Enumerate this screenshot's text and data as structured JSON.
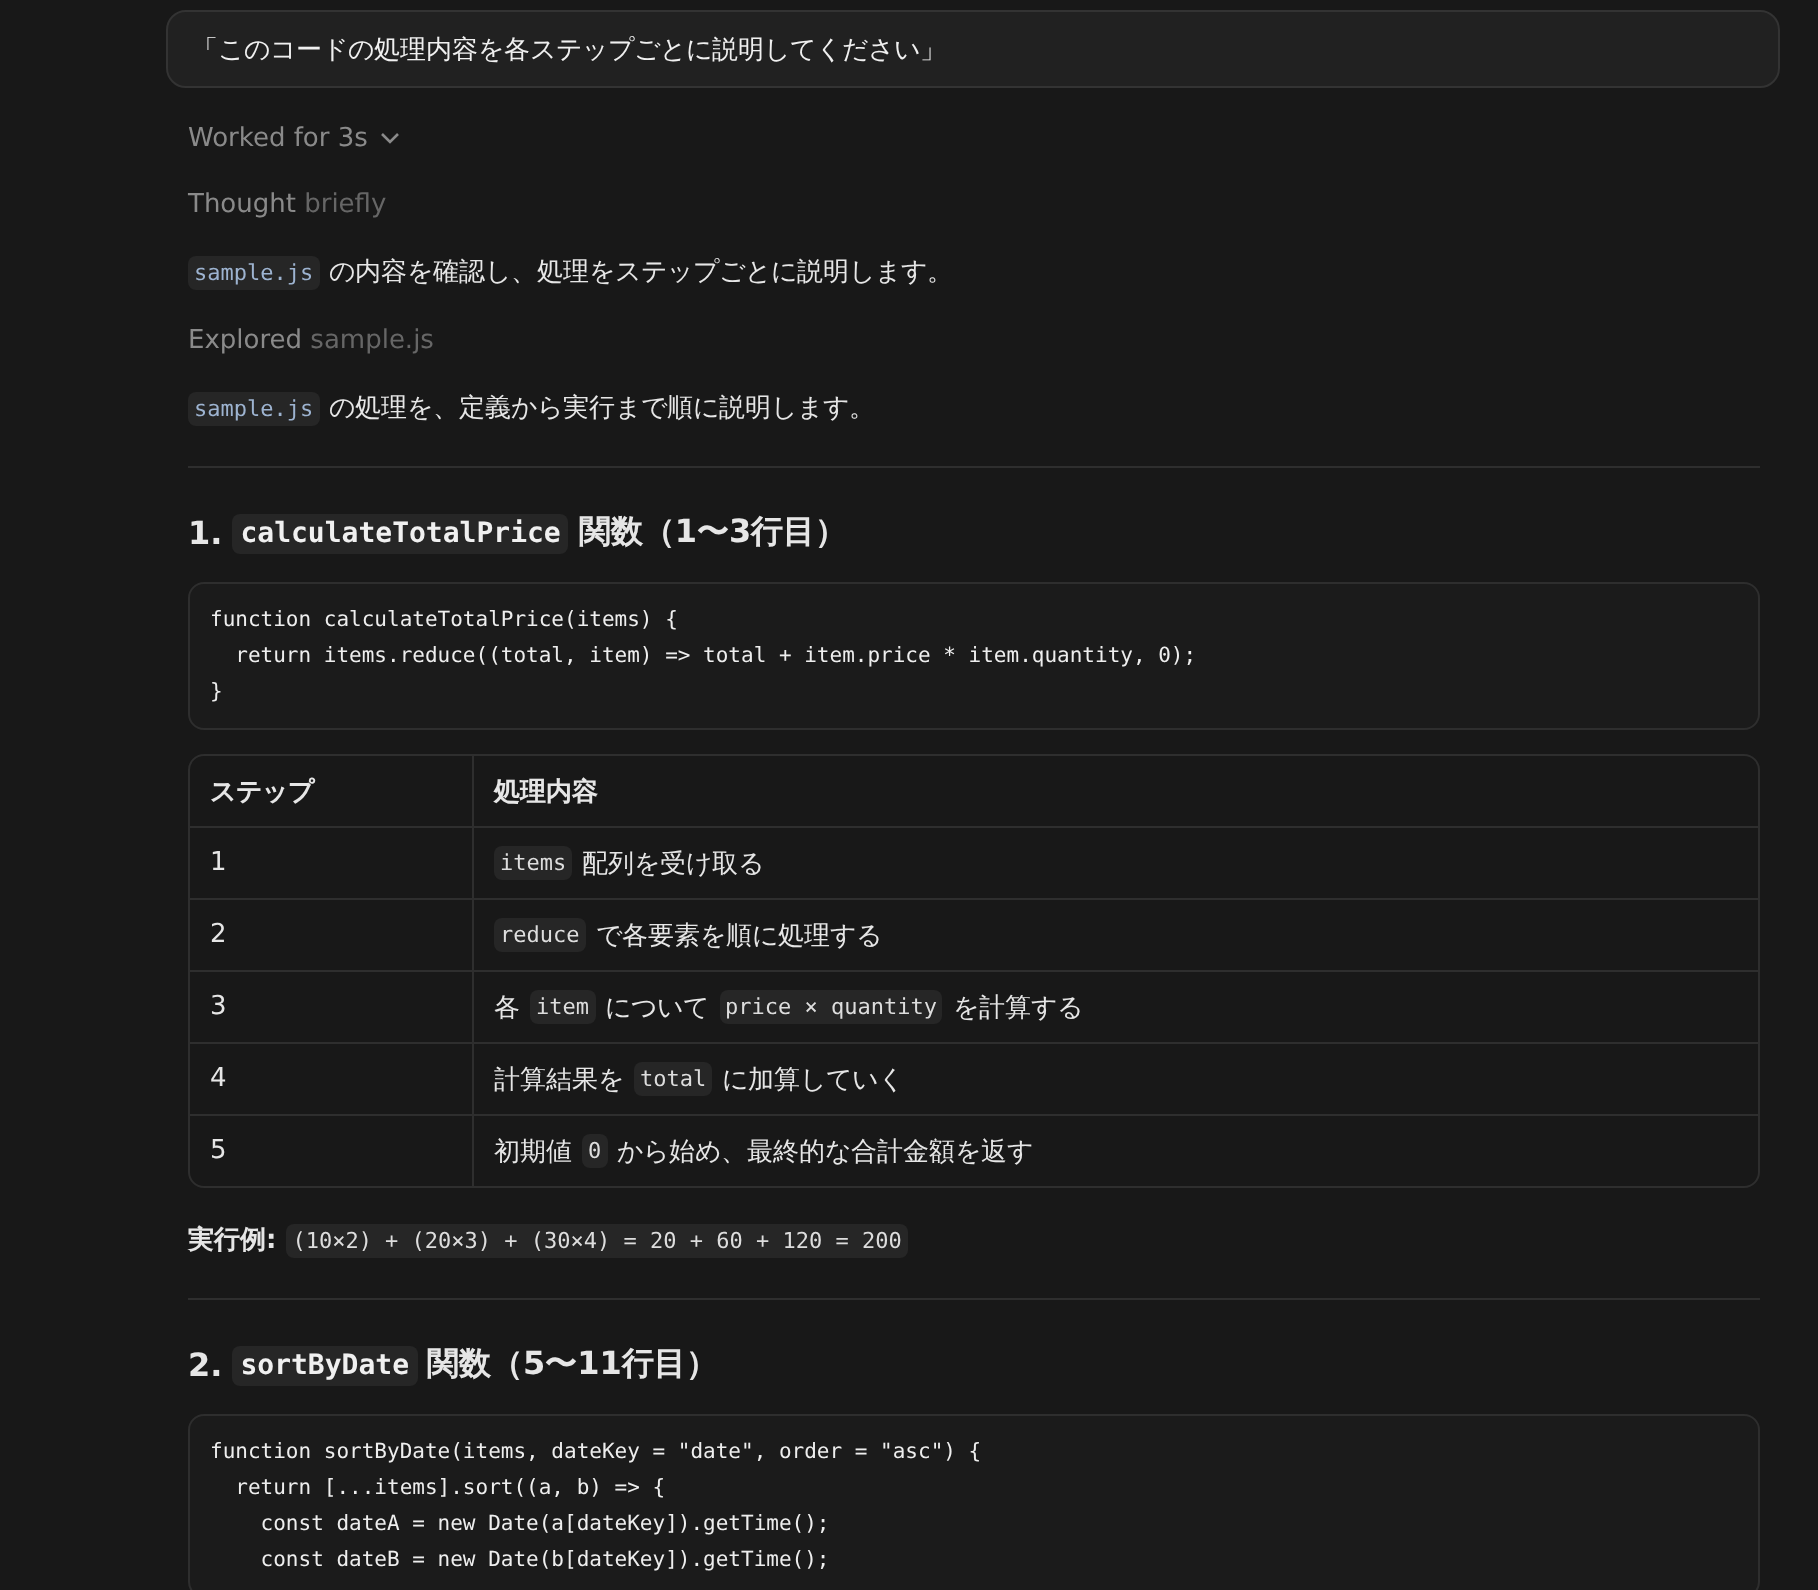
{
  "prompt": "「このコードの処理内容を各ステップごとに説明してください」",
  "worked": {
    "label": "Worked for 3s",
    "expanded": false
  },
  "blocks": [
    {
      "kind": "activity",
      "verb": "Thought",
      "detail": "briefly"
    },
    {
      "kind": "para",
      "parts": [
        {
          "kind": "code",
          "text": "sample.js"
        },
        {
          "kind": "text",
          "text": "の内容を確認し、処理をステップごとに説明します。"
        }
      ]
    },
    {
      "kind": "activity",
      "verb": "Explored",
      "detail": "sample.js"
    },
    {
      "kind": "para",
      "parts": [
        {
          "kind": "code",
          "text": "sample.js"
        },
        {
          "kind": "text",
          "text": "の処理を、定義から実行まで順に説明します。"
        }
      ]
    },
    {
      "kind": "rule"
    },
    {
      "kind": "heading",
      "parts": [
        {
          "kind": "text",
          "text": "1."
        },
        {
          "kind": "code",
          "text": "calculateTotalPrice"
        },
        {
          "kind": "text",
          "text": "関数（1〜3行目）"
        }
      ]
    },
    {
      "kind": "codeblock",
      "lines": [
        "function calculateTotalPrice(items) {",
        "  return items.reduce((total, item) => total + item.price * item.quantity, 0);",
        "}"
      ]
    },
    {
      "kind": "table",
      "columns": [
        "ステップ",
        "処理内容"
      ],
      "rows": [
        {
          "step": "1",
          "parts": [
            {
              "kind": "code",
              "text": "items"
            },
            {
              "kind": "text",
              "text": "配列を受け取る"
            }
          ]
        },
        {
          "step": "2",
          "parts": [
            {
              "kind": "code",
              "text": "reduce"
            },
            {
              "kind": "text",
              "text": "で各要素を順に処理する"
            }
          ]
        },
        {
          "step": "3",
          "parts": [
            {
              "kind": "text",
              "text": "各"
            },
            {
              "kind": "code",
              "text": "item"
            },
            {
              "kind": "text",
              "text": "について"
            },
            {
              "kind": "code",
              "text": "price × quantity"
            },
            {
              "kind": "text",
              "text": "を計算する"
            }
          ]
        },
        {
          "step": "4",
          "parts": [
            {
              "kind": "text",
              "text": "計算結果を"
            },
            {
              "kind": "code",
              "text": "total"
            },
            {
              "kind": "text",
              "text": "に加算していく"
            }
          ]
        },
        {
          "step": "5",
          "parts": [
            {
              "kind": "text",
              "text": "初期値"
            },
            {
              "kind": "code",
              "text": "0"
            },
            {
              "kind": "text",
              "text": "から始め、最終的な合計金額を返す"
            }
          ]
        }
      ]
    },
    {
      "kind": "para",
      "parts": [
        {
          "kind": "bold",
          "text": "実行例:"
        },
        {
          "kind": "code",
          "text": "(10×2) + (20×3) + (30×4) = 20 + 60 + 120 = 200"
        }
      ]
    },
    {
      "kind": "rule"
    },
    {
      "kind": "heading",
      "parts": [
        {
          "kind": "text",
          "text": "2."
        },
        {
          "kind": "code",
          "text": "sortByDate"
        },
        {
          "kind": "text",
          "text": "関数（5〜11行目）"
        }
      ]
    },
    {
      "kind": "codeblock",
      "lines": [
        "function sortByDate(items, dateKey = \"date\", order = \"asc\") {",
        "  return [...items].sort((a, b) => {",
        "    const dateA = new Date(a[dateKey]).getTime();",
        "    const dateB = new Date(b[dateKey]).getTime();"
      ]
    }
  ]
}
